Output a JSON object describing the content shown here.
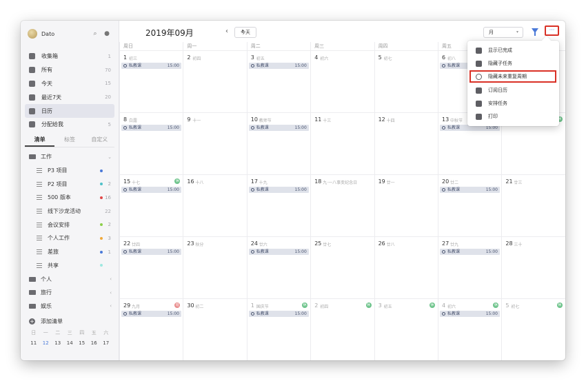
{
  "sidebar": {
    "username": "Dato",
    "nav": [
      {
        "label": "收集箱",
        "count": "1"
      },
      {
        "label": "所有",
        "count": "70"
      },
      {
        "label": "今天",
        "count": "15"
      },
      {
        "label": "最近7天",
        "count": "20"
      },
      {
        "label": "日历",
        "count": ""
      },
      {
        "label": "分配给我",
        "count": "5"
      }
    ],
    "tabs": [
      "清单",
      "标签",
      "自定义"
    ],
    "lists": [
      {
        "label": "工作",
        "count": "",
        "kind": "folder"
      },
      {
        "label": "P3 项目",
        "count": "",
        "kind": "list",
        "dot": "#4a79d8"
      },
      {
        "label": "P2 项目",
        "count": "2",
        "kind": "list",
        "dot": "#4fc1c9"
      },
      {
        "label": "500 版本",
        "count": "16",
        "kind": "list",
        "dot": "#e04848"
      },
      {
        "label": "线下沙龙活动",
        "count": "22",
        "kind": "list"
      },
      {
        "label": "会议安排",
        "count": "2",
        "kind": "list",
        "dot": "#8ccf4a"
      },
      {
        "label": "个人工作",
        "count": "3",
        "kind": "list",
        "dot": "#f0a93b"
      },
      {
        "label": "差旅",
        "count": "1",
        "kind": "list",
        "dot": "#4a79d8"
      },
      {
        "label": "共享",
        "count": "",
        "kind": "list",
        "dot": "#9ee8e0"
      },
      {
        "label": "个人",
        "count": "",
        "kind": "folder"
      },
      {
        "label": "旅行",
        "count": "",
        "kind": "folder"
      },
      {
        "label": "娱乐",
        "count": "",
        "kind": "folder"
      }
    ],
    "add_list": "添加清单",
    "mini_weekdays": [
      "日",
      "一",
      "二",
      "三",
      "四",
      "五",
      "六"
    ],
    "mini_days": [
      "11",
      "12",
      "13",
      "14",
      "15",
      "16",
      "17"
    ]
  },
  "header": {
    "title": "2019年09月",
    "prev": "‹",
    "next": "›",
    "today": "今天",
    "view": "月",
    "more": "···"
  },
  "weekdays": [
    "周日",
    "周一",
    "周二",
    "周三",
    "周四",
    "周五",
    "周六"
  ],
  "event": {
    "name": "私教课",
    "time": "15:00"
  },
  "weeks": [
    [
      {
        "d": "1",
        "l": "初三",
        "ev": true
      },
      {
        "d": "2",
        "l": "初四"
      },
      {
        "d": "3",
        "l": "初五",
        "ev": true
      },
      {
        "d": "4",
        "l": "初六"
      },
      {
        "d": "5",
        "l": "初七"
      },
      {
        "d": "6",
        "l": "初八",
        "ev": true
      },
      {
        "d": "7",
        "l": "初九"
      }
    ],
    [
      {
        "d": "8",
        "l": "白露",
        "ev": true
      },
      {
        "d": "9",
        "l": "十一"
      },
      {
        "d": "10",
        "l": "教师节",
        "ev": true
      },
      {
        "d": "11",
        "l": "十三"
      },
      {
        "d": "12",
        "l": "十四"
      },
      {
        "d": "13",
        "l": "中秋节",
        "ev": true
      },
      {
        "d": "14",
        "l": "十六",
        "badge": "休"
      }
    ],
    [
      {
        "d": "15",
        "l": "十七",
        "ev": true,
        "badge": "休"
      },
      {
        "d": "16",
        "l": "十八"
      },
      {
        "d": "17",
        "l": "十九",
        "ev": true
      },
      {
        "d": "18",
        "l": "九·一八事变纪念日"
      },
      {
        "d": "19",
        "l": "廿一"
      },
      {
        "d": "20",
        "l": "廿二",
        "ev": true
      },
      {
        "d": "21",
        "l": "廿三"
      }
    ],
    [
      {
        "d": "22",
        "l": "廿四",
        "ev": true
      },
      {
        "d": "23",
        "l": "秋分"
      },
      {
        "d": "24",
        "l": "廿六",
        "ev": true
      },
      {
        "d": "25",
        "l": "廿七"
      },
      {
        "d": "26",
        "l": "廿八"
      },
      {
        "d": "27",
        "l": "廿九",
        "ev": true
      },
      {
        "d": "28",
        "l": "三十"
      }
    ],
    [
      {
        "d": "29",
        "l": "九月",
        "ev": true,
        "badge": "班",
        "badgeColor": "red"
      },
      {
        "d": "30",
        "l": "初二"
      },
      {
        "d": "1",
        "l": "国庆节",
        "ev": true,
        "badge": "休",
        "other": true
      },
      {
        "d": "2",
        "l": "初四",
        "badge": "休",
        "other": true
      },
      {
        "d": "3",
        "l": "初五",
        "badge": "休",
        "other": true
      },
      {
        "d": "4",
        "l": "初六",
        "ev": true,
        "badge": "休",
        "other": true
      },
      {
        "d": "5",
        "l": "初七",
        "badge": "休",
        "other": true
      }
    ]
  ],
  "menu": [
    {
      "label": "显示已完成",
      "icon": "check-square-icon"
    },
    {
      "label": "隐藏子任务",
      "icon": "subtask-icon"
    },
    {
      "label": "隐藏未来重复周期",
      "icon": "repeat-icon"
    },
    {
      "label": "订阅日历",
      "icon": "rss-icon"
    },
    {
      "label": "安排任务",
      "icon": "schedule-icon"
    },
    {
      "label": "打印",
      "icon": "print-icon"
    }
  ]
}
